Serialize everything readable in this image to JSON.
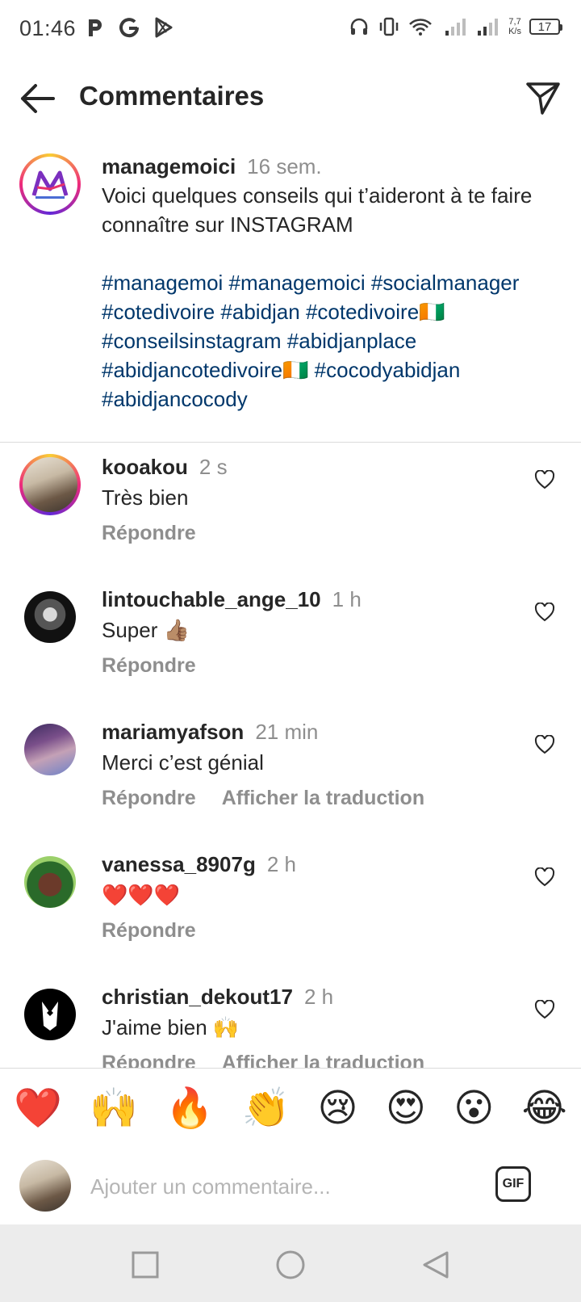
{
  "status_bar": {
    "time": "01:46",
    "app_icons": [
      "parking-icon",
      "google-icon",
      "play-store-icon"
    ],
    "speed_value": "7,7",
    "speed_unit": "K/s",
    "battery": "17"
  },
  "header": {
    "title": "Commentaires"
  },
  "caption": {
    "username": "managemoici",
    "time": "16 sem.",
    "text": "Voici quelques conseils qui t’aideront à te faire connaître sur INSTAGRAM",
    "hashtags": "#managemoi #managemoici #socialmanager #cotedivoire #abidjan #cotedivoire🇨🇮 #conseilsinstagram #abidjanplace #abidjancotedivoire🇨🇮 #cocodyabidjan #abidjancocody"
  },
  "comments": [
    {
      "username": "kooakou",
      "time": "2 s",
      "text": "Très bien",
      "reply": "Répondre",
      "translate": ""
    },
    {
      "username": "lintouchable_ange_10",
      "time": "1 h",
      "text": "Super 👍🏽",
      "reply": "Répondre",
      "translate": ""
    },
    {
      "username": "mariamyafson",
      "time": "21 min",
      "text": "Merci c’est génial",
      "reply": "Répondre",
      "translate": "Afficher la traduction"
    },
    {
      "username": "vanessa_8907g",
      "time": "2 h",
      "text": "❤️❤️❤️",
      "reply": "Répondre",
      "translate": ""
    },
    {
      "username": "christian_dekout17",
      "time": "2 h",
      "text": "J'aime bien 🙌",
      "reply": "Répondre",
      "translate": "Afficher la traduction"
    }
  ],
  "emoji_bar": [
    "❤️",
    "🙌",
    "🔥",
    "👏",
    "😢",
    "😍",
    "😮",
    "😂"
  ],
  "input": {
    "placeholder": "Ajouter un commentaire...",
    "gif_label": "GIF"
  },
  "colors": {
    "hashtag": "#00376b",
    "secondary_text": "#8e8e8e",
    "primary_text": "#262626"
  }
}
